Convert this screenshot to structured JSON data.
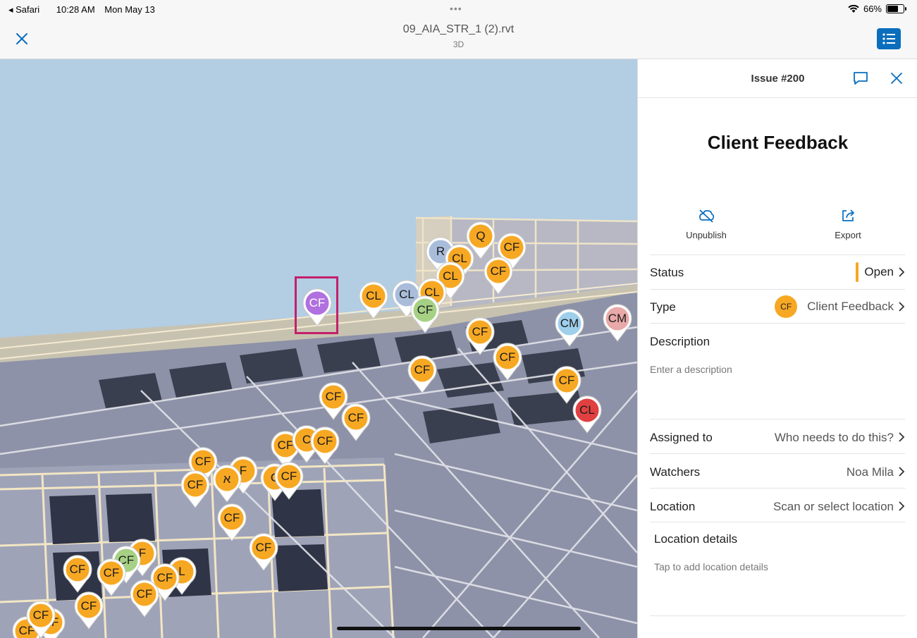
{
  "statusbar": {
    "app": "Safari",
    "time": "10:28 AM",
    "date": "Mon May 13",
    "battery": "66%"
  },
  "titlebar": {
    "filename": "09_AIA_STR_1 (2).rvt",
    "view": "3D"
  },
  "icons": {
    "close": "close-icon",
    "list": "list-icon",
    "comment": "comment-icon",
    "unpublish": "unpublish-icon",
    "export": "export-icon",
    "chevron": "chevron-right-icon"
  },
  "colors": {
    "accent": "#0a6ebd",
    "orange": "#f7a823",
    "purple": "#b070e0",
    "green": "#a6d185",
    "blue": "#9fcfeb",
    "pink": "#e8a9a8",
    "red": "#e04040",
    "highlight": "#c41f6b",
    "sky": "#b3cde3"
  },
  "pins": [
    {
      "label": "CF",
      "color": "#b070e0",
      "selected": true
    },
    {
      "label": "Q",
      "color": "#f7a823"
    },
    {
      "label": "R",
      "color": "#a9bddb"
    },
    {
      "label": "CL",
      "color": "#f7a823"
    },
    {
      "label": "CF",
      "color": "#f7a823"
    },
    {
      "label": "CF",
      "color": "#f7a823"
    },
    {
      "label": "CL",
      "color": "#f7a823"
    },
    {
      "label": "CL",
      "color": "#f7a823"
    },
    {
      "label": "CL",
      "color": "#a9bddb"
    },
    {
      "label": "CL",
      "color": "#f7a823"
    },
    {
      "label": "CF",
      "color": "#a6d185"
    },
    {
      "label": "CM",
      "color": "#9fcfeb"
    },
    {
      "label": "CM",
      "color": "#e8a9a8"
    },
    {
      "label": "CF",
      "color": "#f7a823"
    },
    {
      "label": "CF",
      "color": "#f7a823"
    },
    {
      "label": "CF",
      "color": "#f7a823"
    },
    {
      "label": "CF",
      "color": "#f7a823"
    },
    {
      "label": "CL",
      "color": "#e04040"
    },
    {
      "label": "CF",
      "color": "#f7a823"
    },
    {
      "label": "CF",
      "color": "#f7a823"
    },
    {
      "label": "CF",
      "color": "#f7a823"
    },
    {
      "label": "C",
      "color": "#f7a823"
    },
    {
      "label": "CF",
      "color": "#f7a823"
    },
    {
      "label": "CF",
      "color": "#f7a823"
    },
    {
      "label": "F",
      "color": "#f7a823"
    },
    {
      "label": "CF",
      "color": "#f7a823"
    },
    {
      "label": "א",
      "color": "#f7a823"
    },
    {
      "label": "C",
      "color": "#f7a823"
    },
    {
      "label": "CF",
      "color": "#f7a823"
    },
    {
      "label": "CF",
      "color": "#f7a823"
    },
    {
      "label": "CF",
      "color": "#f7a823"
    },
    {
      "label": "F",
      "color": "#f7a823"
    },
    {
      "label": "CF",
      "color": "#a6d185"
    },
    {
      "label": "CF",
      "color": "#f7a823"
    },
    {
      "label": "CF",
      "color": "#f7a823"
    },
    {
      "label": "L",
      "color": "#f7a823"
    },
    {
      "label": "CF",
      "color": "#f7a823"
    },
    {
      "label": "CF",
      "color": "#f7a823"
    },
    {
      "label": "CF",
      "color": "#f7a823"
    },
    {
      "label": "CF",
      "color": "#f7a823"
    },
    {
      "label": "CF",
      "color": "#f7a823"
    },
    {
      "label": "CF",
      "color": "#f7a823"
    }
  ],
  "panel": {
    "issue_number": "Issue #200",
    "title": "Client Feedback",
    "actions": {
      "unpublish": "Unpublish",
      "export": "Export"
    },
    "fields": {
      "status": {
        "label": "Status",
        "value": "Open"
      },
      "type": {
        "label": "Type",
        "value": "Client Feedback",
        "avatar": "CF"
      },
      "description": {
        "label": "Description",
        "placeholder": "Enter a description"
      },
      "assigned": {
        "label": "Assigned to",
        "value": "Who needs to do this?"
      },
      "watchers": {
        "label": "Watchers",
        "value": "Noa Mila"
      },
      "location": {
        "label": "Location",
        "value": "Scan or select location"
      },
      "location_details": {
        "label": "Location details",
        "placeholder": "Tap to add location details"
      }
    }
  }
}
